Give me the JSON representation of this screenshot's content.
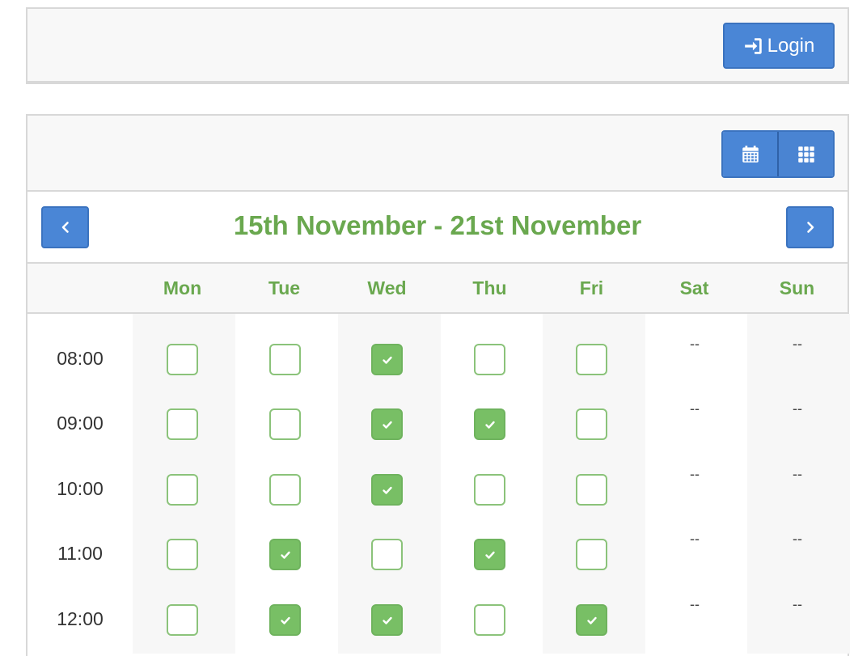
{
  "topbar": {
    "login_label": "Login",
    "login_icon": "sign-in-icon"
  },
  "calendar": {
    "view_buttons": [
      {
        "name": "calendar-view-button",
        "icon": "calendar-icon"
      },
      {
        "name": "grid-view-button",
        "icon": "th-icon"
      }
    ],
    "week_title": "15th November - 21st November",
    "prev_icon": "chevron-left-icon",
    "next_icon": "chevron-right-icon",
    "days": [
      "Mon",
      "Tue",
      "Wed",
      "Thu",
      "Fri",
      "Sat",
      "Sun"
    ],
    "rows": [
      {
        "time": "08:00",
        "slots": [
          false,
          false,
          true,
          false,
          false,
          "--",
          "--"
        ]
      },
      {
        "time": "09:00",
        "slots": [
          false,
          false,
          true,
          true,
          false,
          "--",
          "--"
        ]
      },
      {
        "time": "10:00",
        "slots": [
          false,
          false,
          true,
          false,
          false,
          "--",
          "--"
        ]
      },
      {
        "time": "11:00",
        "slots": [
          false,
          true,
          false,
          true,
          false,
          "--",
          "--"
        ]
      },
      {
        "time": "12:00",
        "slots": [
          false,
          true,
          true,
          false,
          true,
          "--",
          "--"
        ]
      }
    ]
  },
  "colors": {
    "accent_blue": "#4a86d6",
    "accent_green": "#6aa84f",
    "check_green": "#78bf65"
  }
}
